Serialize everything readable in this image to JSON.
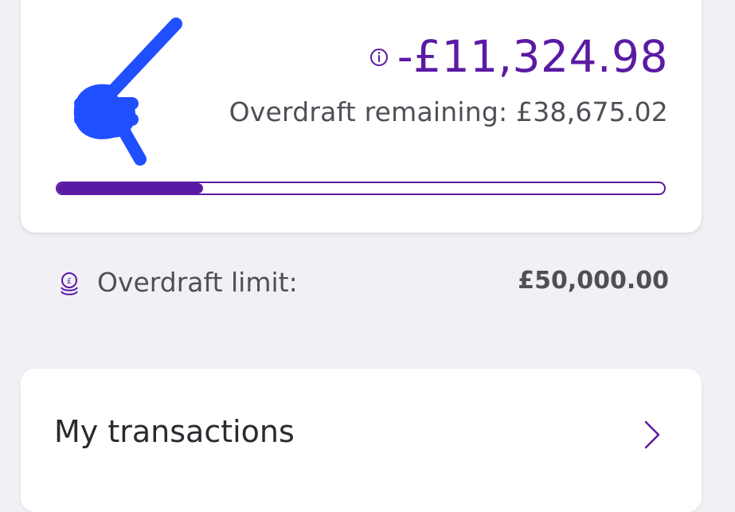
{
  "balance_card": {
    "balance": "-£11,324.98",
    "overdraft_remaining": "Overdraft remaining: £38,675.02",
    "overdraft_used_fraction": 0.24,
    "icons": [
      "info-icon"
    ]
  },
  "overdraft_limit": {
    "label": "Overdraft limit:",
    "value": "£50,000.00",
    "icon": "coins-icon"
  },
  "transactions": {
    "label": "My transactions",
    "icon": "chevron-right-icon"
  },
  "colors": {
    "accent": "#5b1aa3",
    "background": "#f1f0f5",
    "card": "#ffffff",
    "redaction": "#1f4fff"
  }
}
